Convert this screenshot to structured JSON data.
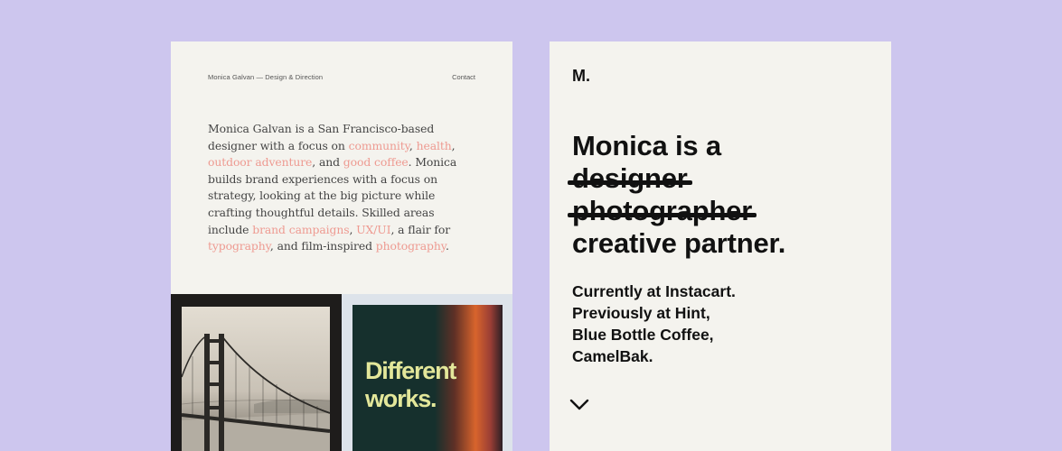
{
  "left": {
    "nav": {
      "brand": "Monica Galvan — Design & Direction",
      "contact": "Contact"
    },
    "bio": {
      "t1": "Monica Galvan is a San Francisco-based designer with a focus on ",
      "l1": "community",
      "t2": ", ",
      "l2": "health",
      "t3": ", ",
      "l3": "outdoor adventure",
      "t4": ", and ",
      "l4": "good coffee",
      "t5": ". Monica builds brand experiences with a focus on strategy, looking at the big picture while crafting thoughtful details. Skilled areas include ",
      "l5": "brand campaigns",
      "t6": ", ",
      "l6": "UX/UI",
      "t7": ", a flair for ",
      "l7": "typography",
      "t8": ", and film-inspired ",
      "l8": "photography",
      "t9": "."
    },
    "poster_text": "Different\nworks."
  },
  "right": {
    "logo": "M.",
    "headline": {
      "line1": "Monica is a",
      "struck1": "designer",
      "struck2": "photographer",
      "line4": "creative partner."
    },
    "current": [
      "Currently at Instacart.",
      "Previously at Hint,",
      "Blue Bottle Coffee,",
      "CamelBak."
    ],
    "scroll_icon": "chevron-down-icon"
  },
  "colors": {
    "background": "#cdc6ee",
    "card": "#f4f3ee",
    "accent": "#ee9a91",
    "text": "#111111"
  }
}
